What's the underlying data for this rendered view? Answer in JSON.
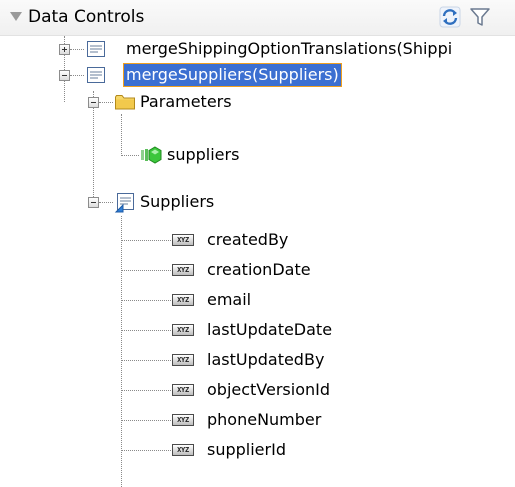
{
  "panel": {
    "title": "Data Controls",
    "icons": {
      "refresh": "refresh-icon",
      "filter": "filter-icon"
    }
  },
  "tree": {
    "nodes": [
      {
        "label": "mergeShippingOptionTranslations(Shippi",
        "expanded": false,
        "icon": "method-icon"
      },
      {
        "label": "mergeSuppliers(Suppliers)",
        "expanded": true,
        "selected": true,
        "icon": "method-icon"
      },
      {
        "label": "Parameters",
        "expanded": true,
        "icon": "folder-icon"
      },
      {
        "label": "suppliers",
        "icon": "parameter-icon"
      },
      {
        "label": "Suppliers",
        "expanded": true,
        "icon": "collection-icon"
      },
      {
        "label": "createdBy",
        "icon": "attribute-icon"
      },
      {
        "label": "creationDate",
        "icon": "attribute-icon"
      },
      {
        "label": "email",
        "icon": "attribute-icon"
      },
      {
        "label": "lastUpdateDate",
        "icon": "attribute-icon"
      },
      {
        "label": "lastUpdatedBy",
        "icon": "attribute-icon"
      },
      {
        "label": "objectVersionId",
        "icon": "attribute-icon"
      },
      {
        "label": "phoneNumber",
        "icon": "attribute-icon"
      },
      {
        "label": "supplierId",
        "icon": "attribute-icon"
      }
    ],
    "attribute_badge": "XYZ"
  },
  "colors": {
    "selection": "#3b6fd1",
    "selection_border": "#f0a020",
    "folder": "#f2c94c",
    "parameter": "#3cc63c"
  }
}
